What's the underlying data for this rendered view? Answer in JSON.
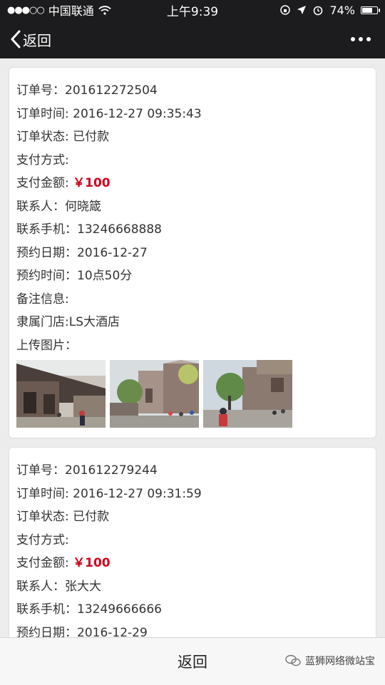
{
  "status_bar": {
    "signal_icon": "signal-dots-icon",
    "carrier": "中国联通",
    "wifi_icon": "wifi-icon",
    "time": "上午9:39",
    "battery_percent_label": "74%",
    "battery_level": 0.74
  },
  "nav": {
    "back_label": "返回",
    "more_icon": "more-dots-icon"
  },
  "orders": [
    {
      "rows": [
        {
          "label": "订单号：",
          "value": "201612272504"
        },
        {
          "label": "订单时间: ",
          "value": "2016-12-27 09:35:43"
        },
        {
          "label": "订单状态: ",
          "value": "已付款"
        },
        {
          "label": "支付方式:",
          "value": ""
        },
        {
          "label": "支付金额: ",
          "value": "￥100",
          "highlight": true
        },
        {
          "label": "联系人：",
          "value": "何晓箴"
        },
        {
          "label": "联系手机：",
          "value": "13246668888"
        },
        {
          "label": "预约日期：",
          "value": "2016-12-27"
        },
        {
          "label": "预约时间：",
          "value": "10点50分"
        },
        {
          "label": "备注信息:",
          "value": ""
        },
        {
          "label": "隶属门店:",
          "value": "LS大酒店"
        },
        {
          "label": "上传图片：",
          "value": ""
        }
      ],
      "images": [
        "photo-street-1",
        "photo-street-2",
        "photo-street-3"
      ]
    },
    {
      "rows": [
        {
          "label": "订单号：",
          "value": "201612279244"
        },
        {
          "label": "订单时间: ",
          "value": "2016-12-27 09:31:59"
        },
        {
          "label": "订单状态: ",
          "value": "已付款"
        },
        {
          "label": "支付方式:",
          "value": ""
        },
        {
          "label": "支付金额: ",
          "value": "￥100",
          "highlight": true
        },
        {
          "label": "联系人：",
          "value": "张大大"
        },
        {
          "label": "联系手机：",
          "value": "13249666666"
        },
        {
          "label": "预约日期：",
          "value": "2016-12-29"
        }
      ],
      "images": []
    }
  ],
  "bottom": {
    "back_label": "返回",
    "watermark_text": "蓝狮网络微站宝"
  }
}
